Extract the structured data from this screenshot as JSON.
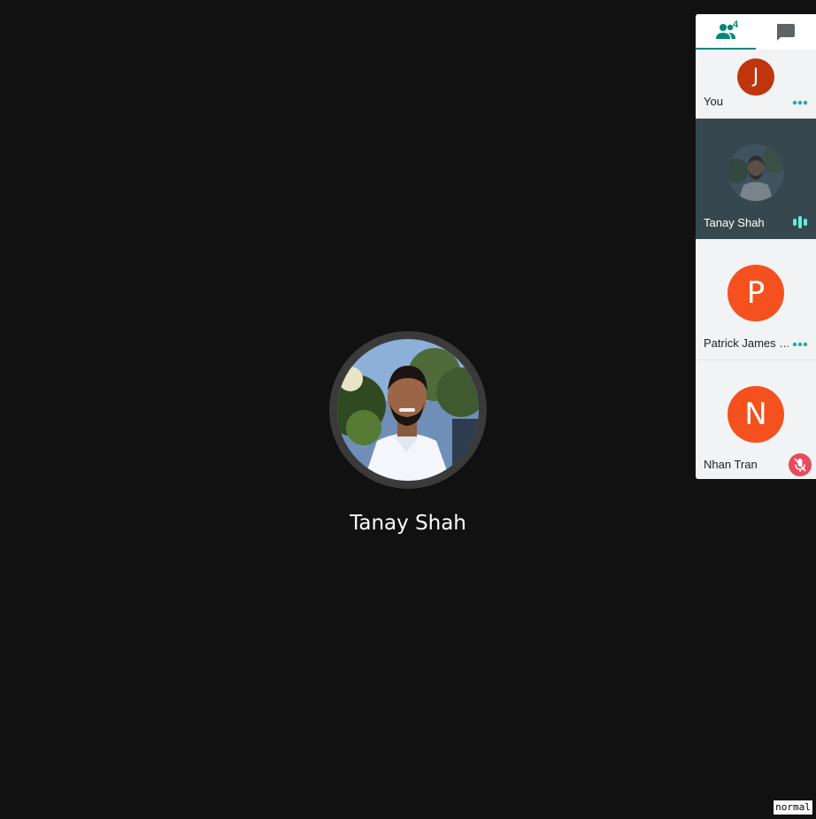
{
  "featured": {
    "name": "Tanay Shah"
  },
  "panel": {
    "tabs": [
      {
        "name": "participants",
        "icon": "people-icon",
        "badge": "4",
        "active": true
      },
      {
        "name": "chat",
        "icon": "chat-icon",
        "active": false
      }
    ],
    "participants": [
      {
        "name": "You",
        "initial": "J",
        "avatar_color": "#bf360c",
        "status": "more-options"
      },
      {
        "name": "Tanay Shah",
        "initial": "",
        "status": "speaking"
      },
      {
        "name": "Patrick James …",
        "initial": "P",
        "avatar_color": "#f4511e",
        "status": "more-options"
      },
      {
        "name": "Nhan Tran",
        "initial": "N",
        "avatar_color": "#f4511e",
        "status": "muted"
      }
    ]
  },
  "mode_label": "normal",
  "colors": {
    "background": "#111111",
    "accent": "#00897b",
    "speaking_tile": "#37474f",
    "muted_badge": "#e84a5f"
  }
}
